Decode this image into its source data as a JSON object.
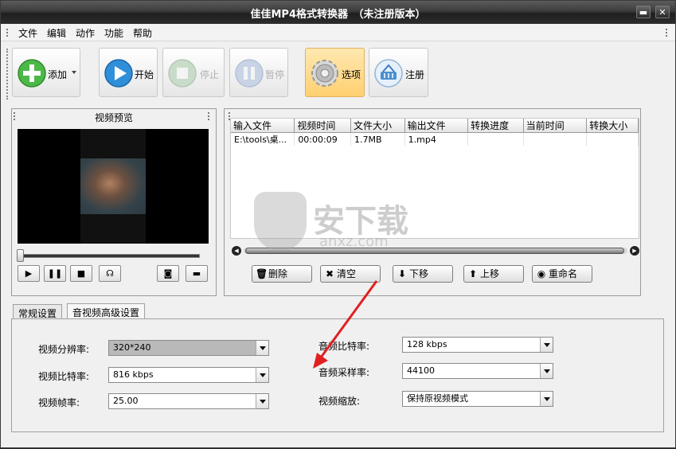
{
  "window": {
    "title": "佳佳MP4格式转换器　（未注册版本）",
    "min_label": "▬",
    "close_label": "✕"
  },
  "menu": [
    "文件",
    "编辑",
    "动作",
    "功能",
    "帮助"
  ],
  "toolbar": {
    "add": "添加",
    "start": "开始",
    "stop": "停止",
    "pause": "暂停",
    "options": "选项",
    "register": "注册"
  },
  "preview": {
    "title": "视频预览",
    "seek_progress": 0
  },
  "filelist": {
    "columns": [
      "输入文件",
      "视频时间",
      "文件大小",
      "输出文件",
      "转换进度",
      "当前时间",
      "转换大小"
    ],
    "rows": [
      [
        "E:\\tools\\桌...",
        "00:00:09",
        "1.7MB",
        "1.mp4",
        "",
        "",
        ""
      ]
    ],
    "buttons": {
      "delete": "删除",
      "clear": "清空",
      "down": "下移",
      "up": "上移",
      "rename": "重命名"
    }
  },
  "tabs": [
    "常规设置",
    "音视频高级设置"
  ],
  "settings": {
    "video_resolution": {
      "label": "视频分辨率:",
      "value": "320*240"
    },
    "video_bitrate": {
      "label": "视频比特率:",
      "value": "816 kbps"
    },
    "video_fps": {
      "label": "视频帧率:",
      "value": "25.00"
    },
    "audio_bitrate": {
      "label": "音频比特率:",
      "value": "128 kbps"
    },
    "audio_samplerate": {
      "label": "音频采样率:",
      "value": "44100"
    },
    "video_scale": {
      "label": "视频缩放:",
      "value": "保持原视频模式"
    }
  },
  "watermark": {
    "text": "安下载",
    "sub": "anxz.com"
  },
  "colors": {
    "title_bar": "#2d2d2d",
    "options_active": "#ffd070",
    "arrow": "#e02020"
  }
}
